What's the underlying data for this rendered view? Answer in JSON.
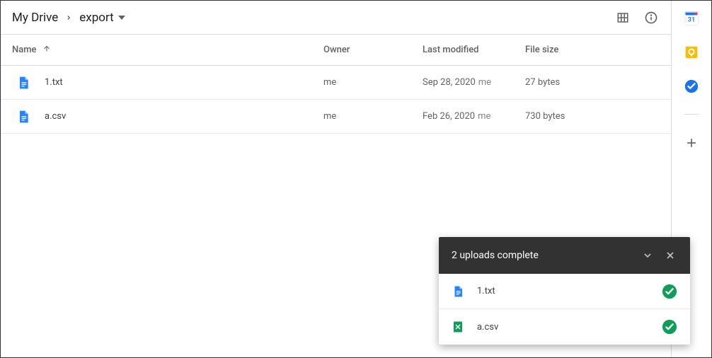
{
  "breadcrumb": {
    "root": "My Drive",
    "current": "export"
  },
  "columns": {
    "name": "Name",
    "owner": "Owner",
    "modified": "Last modified",
    "size": "File size"
  },
  "files": [
    {
      "icon": "docs-blue-icon",
      "name": "1.txt",
      "owner": "me",
      "modified_date": "Sep 28, 2020",
      "modified_by": "me",
      "size": "27 bytes"
    },
    {
      "icon": "docs-blue-icon",
      "name": "a.csv",
      "owner": "me",
      "modified_date": "Feb 26, 2020",
      "modified_by": "me",
      "size": "730 bytes"
    }
  ],
  "upload_popup": {
    "title": "2 uploads complete",
    "items": [
      {
        "icon": "docs-blue-icon",
        "name": "1.txt",
        "status": "success"
      },
      {
        "icon": "sheets-green-icon",
        "name": "a.csv",
        "status": "success"
      }
    ]
  },
  "side_panel": {
    "calendar_day": "31"
  }
}
